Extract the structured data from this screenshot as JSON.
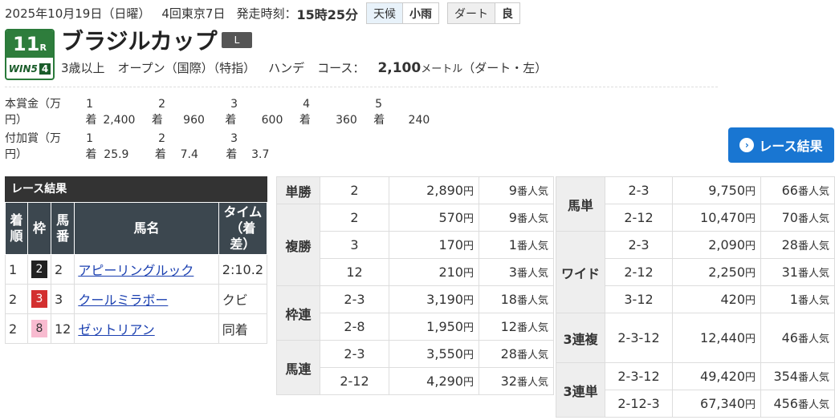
{
  "header": {
    "date": "2025年10月19日（日曜）",
    "meet": "4回東京7日",
    "post_label": "発走時刻：",
    "post_time": "15時25分",
    "weather_label": "天候",
    "weather": "小雨",
    "track_label": "ダート",
    "track_cond": "良"
  },
  "badge": {
    "race_no": "11",
    "race_suffix": "R",
    "win5": "WIN5",
    "win5_no": "4"
  },
  "race": {
    "name": "ブラジルカップ",
    "grade": "L",
    "age": "3歳以上",
    "class": "オープン（国際）（特指）",
    "handicap": "ハンデ",
    "course_label": "コース：",
    "distance": "2,100",
    "unit": "メートル",
    "course_detail": "（ダート・左）"
  },
  "prize": {
    "main_label1": "本賞金（万",
    "main_label2": "円）",
    "main_places": [
      "1",
      "2",
      "3",
      "4",
      "5"
    ],
    "main_values": [
      "2,400",
      "960",
      "600",
      "360",
      "240"
    ],
    "add_label1": "付加賞（万",
    "add_label2": "円）",
    "add_places": [
      "1",
      "2",
      "3"
    ],
    "add_values": [
      "25.9",
      "7.4",
      "3.7"
    ],
    "chaku": "着"
  },
  "result_button": "レース結果",
  "results": {
    "title": "レース結果",
    "headers": [
      "着順",
      "枠",
      "馬番",
      "馬名",
      "タイム（着差）"
    ],
    "rows": [
      {
        "pos": "1",
        "waku": "2",
        "num": "2",
        "name": "アピーリングルック",
        "time": "2:10.2"
      },
      {
        "pos": "2",
        "waku": "3",
        "num": "3",
        "name": "クールミラボー",
        "time": "クビ"
      },
      {
        "pos": "2",
        "waku": "8",
        "num": "12",
        "name": "ゼットリアン",
        "time": "同着"
      }
    ]
  },
  "payout_left": [
    {
      "label": "単勝",
      "rows": [
        {
          "combo": "2",
          "amount": "2,890",
          "pop": "9"
        }
      ]
    },
    {
      "label": "複勝",
      "rows": [
        {
          "combo": "2",
          "amount": "570",
          "pop": "9"
        },
        {
          "combo": "3",
          "amount": "170",
          "pop": "1"
        },
        {
          "combo": "12",
          "amount": "210",
          "pop": "3"
        }
      ]
    },
    {
      "label": "枠連",
      "rows": [
        {
          "combo": "2-3",
          "amount": "3,190",
          "pop": "18"
        },
        {
          "combo": "2-8",
          "amount": "1,950",
          "pop": "12"
        }
      ]
    },
    {
      "label": "馬連",
      "rows": [
        {
          "combo": "2-3",
          "amount": "3,550",
          "pop": "28"
        },
        {
          "combo": "2-12",
          "amount": "4,290",
          "pop": "32"
        }
      ]
    }
  ],
  "payout_right": [
    {
      "label": "馬単",
      "rows": [
        {
          "combo": "2-3",
          "amount": "9,750",
          "pop": "66"
        },
        {
          "combo": "2-12",
          "amount": "10,470",
          "pop": "70"
        }
      ]
    },
    {
      "label": "ワイド",
      "rows": [
        {
          "combo": "2-3",
          "amount": "2,090",
          "pop": "28"
        },
        {
          "combo": "2-12",
          "amount": "2,250",
          "pop": "31"
        },
        {
          "combo": "3-12",
          "amount": "420",
          "pop": "1"
        }
      ]
    },
    {
      "label": "3連複",
      "rows": [
        {
          "combo": "2-3-12",
          "amount": "12,440",
          "pop": "46"
        }
      ]
    },
    {
      "label": "3連単",
      "rows": [
        {
          "combo": "2-3-12",
          "amount": "49,420",
          "pop": "354"
        },
        {
          "combo": "2-12-3",
          "amount": "67,340",
          "pop": "456"
        }
      ]
    }
  ],
  "yen": "円",
  "pop_suffix": "番人気",
  "colors": {
    "waku2": "#222222",
    "waku3": "#d32f2f",
    "waku8": "#f8bbd0",
    "accent": "#1976d2"
  }
}
